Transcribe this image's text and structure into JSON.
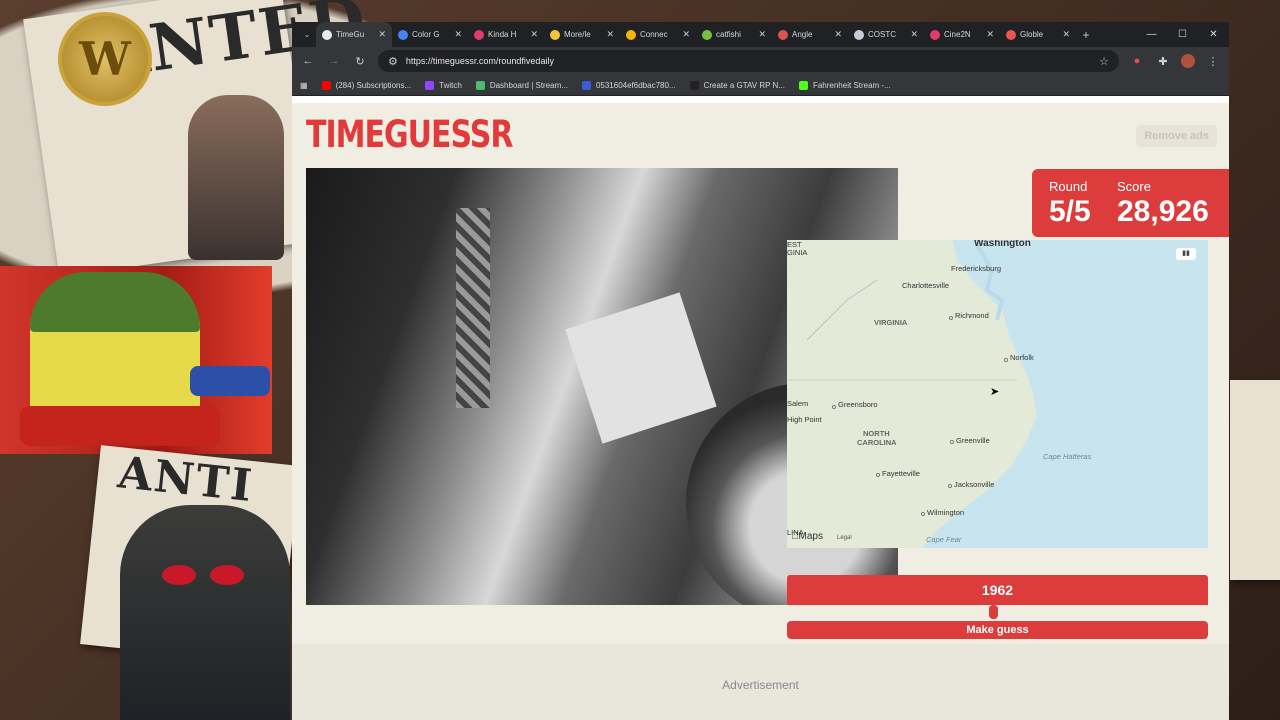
{
  "browser": {
    "tabs": [
      {
        "title": "TimeGu",
        "color": "#e8eaed",
        "active": true
      },
      {
        "title": "Color G",
        "color": "#4285f4"
      },
      {
        "title": "Kinda H",
        "color": "#e03b69"
      },
      {
        "title": "More/le",
        "color": "#f0c53a"
      },
      {
        "title": "Connec",
        "color": "#f4b400"
      },
      {
        "title": "catfishi",
        "color": "#7ac142"
      },
      {
        "title": "Angle",
        "color": "#d9534f"
      },
      {
        "title": "COSTC",
        "color": "#c9c9d8"
      },
      {
        "title": "Cine2N",
        "color": "#e23a6a"
      },
      {
        "title": "Globle",
        "color": "#e8574a"
      }
    ],
    "url": "https://timeguessr.com/roundfivedaily",
    "bookmarks": [
      {
        "label": "(284) Subscriptions...",
        "color": "#ff0000"
      },
      {
        "label": "Twitch",
        "color": "#9146ff"
      },
      {
        "label": "Dashboard | Stream...",
        "color": "#4dbb6b"
      },
      {
        "label": "0531604ef6dbac780...",
        "color": "#3b5bdb"
      },
      {
        "label": "Create a GTAV RP N...",
        "color": "#222222"
      },
      {
        "label": "Fahrenheit Stream -...",
        "color": "#53fc18"
      }
    ]
  },
  "game": {
    "logo": "TIMEGUESSR",
    "remove_ads": "Remove ads",
    "round_label": "Round",
    "round_value": "5/5",
    "score_label": "Score",
    "score_value": "28,926",
    "year": "1962",
    "make_guess": "Make guess",
    "advertisement": "Advertisement"
  },
  "map": {
    "brand": "Maps",
    "legal": "Legal",
    "labels": {
      "washington": "Washington",
      "fredericksburg": "Fredericksburg",
      "charlottesville": "Charlottesville",
      "virginia": "VIRGINIA",
      "richmond": "Richmond",
      "norfolk": "Norfolk",
      "salem": "Salem",
      "greensboro": "Greensboro",
      "high_point": "High Point",
      "north": "NORTH",
      "carolina": "CAROLINA",
      "greenville": "Greenville",
      "cape_hatteras": "Cape Hatteras",
      "fayetteville": "Fayetteville",
      "jacksonville": "Jacksonville",
      "wilmington": "Wilmington",
      "cape_fear": "Cape Fear",
      "edge_top": "EST",
      "edge_top2": "GINIA",
      "edge_bottom": "LINA"
    }
  },
  "colors": {
    "accent": "#dc3c3c",
    "page_bg": "#f0ede3",
    "sea": "#c8e5ef",
    "land": "#e3ead7"
  }
}
